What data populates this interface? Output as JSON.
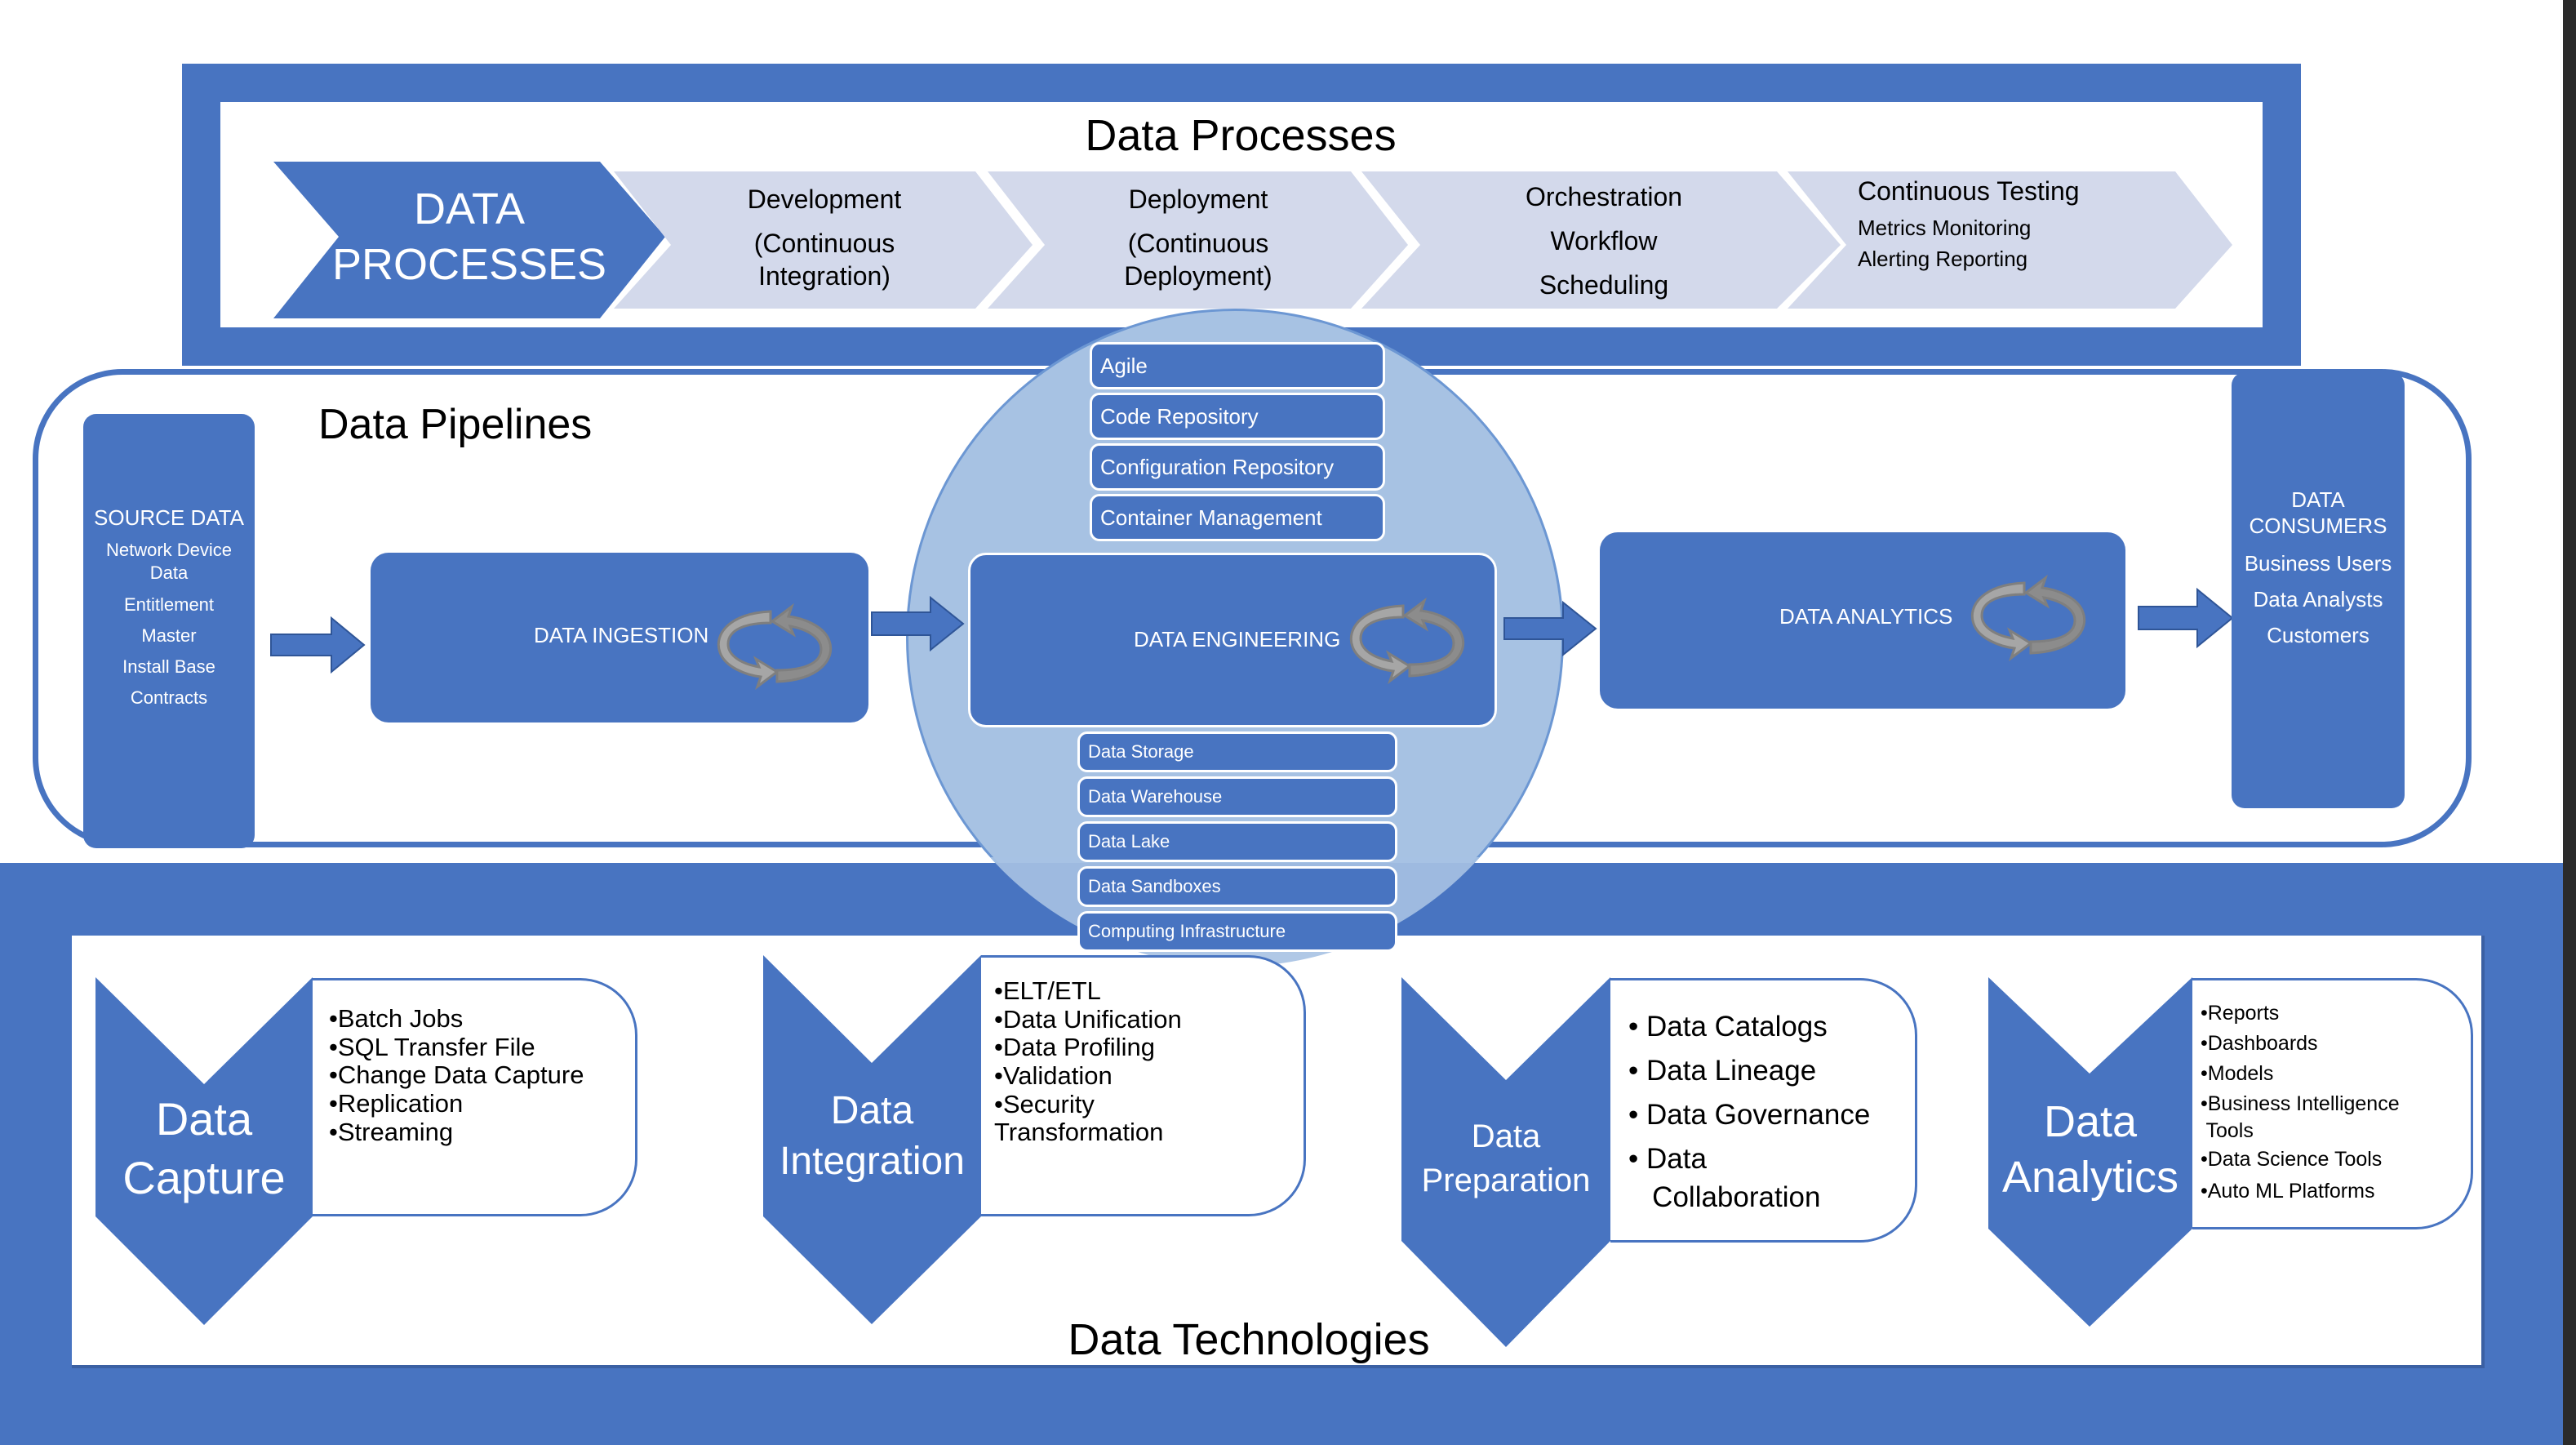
{
  "processes": {
    "title": "Data Processes",
    "lead_chevron": [
      "DATA",
      "PROCESSES"
    ],
    "steps": [
      {
        "lines": [
          "Development",
          "(Continuous",
          "Integration)"
        ]
      },
      {
        "lines": [
          "Deployment",
          "(Continuous",
          "Deployment)"
        ]
      },
      {
        "lines": [
          "Orchestration",
          "Workflow",
          "Scheduling"
        ]
      },
      {
        "heading": "Continuous Testing",
        "lines": [
          "Metrics  Monitoring",
          "Alerting Reporting"
        ]
      }
    ]
  },
  "pipelines": {
    "title": "Data Pipelines",
    "source": {
      "title": "SOURCE DATA",
      "items": [
        "Network Device Data",
        "Entitlement",
        "Master",
        "Install Base",
        "Contracts"
      ]
    },
    "stages": [
      {
        "label": "DATA INGESTION",
        "icon": "cycle-arrows-icon"
      },
      {
        "label": "DATA ENGINEERING",
        "icon": "cycle-arrows-icon"
      },
      {
        "label": "DATA ANALYTICS",
        "icon": "cycle-arrows-icon"
      }
    ],
    "engineering_top": [
      "Agile",
      "Code Repository",
      "Configuration Repository",
      "Container Management"
    ],
    "engineering_bottom": [
      "Data Storage",
      "Data Warehouse",
      "Data Lake",
      "Data Sandboxes",
      "Computing Infrastructure"
    ],
    "consumers": {
      "title_lines": [
        "DATA",
        "CONSUMERS"
      ],
      "items": [
        "Business Users",
        "Data Analysts",
        "Customers"
      ]
    }
  },
  "technologies": {
    "title": "Data Technologies",
    "groups": [
      {
        "title_lines": [
          "Data",
          "Capture"
        ],
        "items": [
          "•Batch Jobs",
          "•SQL Transfer File",
          "•Change Data Capture",
          "•Replication",
          "•Streaming"
        ]
      },
      {
        "title_lines": [
          "Data",
          "Integration"
        ],
        "items": [
          "•ELT/ETL",
          "•Data Unification",
          "•Data Profiling",
          "•Validation",
          "•Security",
          " Transformation"
        ]
      },
      {
        "title_lines": [
          "Data",
          "Preparation"
        ],
        "items": [
          "• Data Catalogs",
          "• Data Lineage",
          "• Data Governance",
          "• Data",
          "   Collaboration"
        ]
      },
      {
        "title_lines": [
          "Data",
          "Analytics"
        ],
        "items": [
          "•Reports",
          "•Dashboards",
          "•Models",
          "•Business Intelligence",
          " Tools",
          "•Data Science Tools",
          "•Auto ML Platforms"
        ]
      }
    ]
  },
  "colors": {
    "primary": "#4874C1",
    "light_chevron": "#D3D9EB",
    "circle": "#A7C2E3",
    "cycle_icon": "#8C8C8C"
  }
}
